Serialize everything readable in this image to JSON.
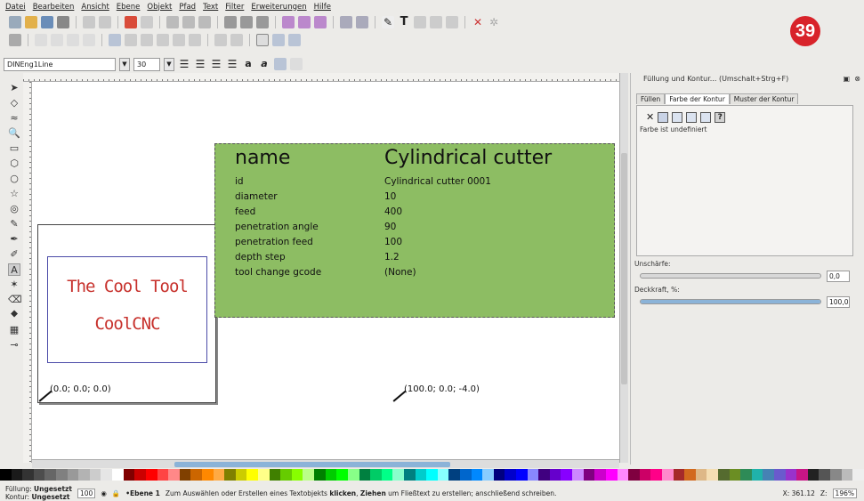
{
  "menu": [
    "Datei",
    "Bearbeiten",
    "Ansicht",
    "Ebene",
    "Objekt",
    "Pfad",
    "Text",
    "Filter",
    "Erweiterungen",
    "Hilfe"
  ],
  "badge": "39",
  "fontbar": {
    "font_family": "DINEng1Line",
    "font_size": "30"
  },
  "tools": [
    "selector-tool",
    "node-tool",
    "tweak-tool",
    "zoom-tool",
    "rect-tool",
    "box3d-tool",
    "circle-tool",
    "star-tool",
    "spiral-tool",
    "pencil-tool",
    "pen-tool",
    "calligraphy-tool",
    "text-tool",
    "spray-tool",
    "eraser-tool",
    "bucket-tool",
    "gradient-tool",
    "dropper-tool"
  ],
  "canvas": {
    "cool_tool_line1": "The Cool Tool",
    "cool_tool_line2": "CoolCNC",
    "green_box": {
      "name_label": "name",
      "name_value": "Cylindrical cutter",
      "rows": [
        {
          "label": "id",
          "value": "Cylindrical cutter 0001"
        },
        {
          "label": "diameter",
          "value": "10"
        },
        {
          "label": "feed",
          "value": "400"
        },
        {
          "label": "penetration angle",
          "value": "90"
        },
        {
          "label": "penetration feed",
          "value": "100"
        },
        {
          "label": "depth step",
          "value": "1.2"
        },
        {
          "label": "tool change gcode",
          "value": "(None)"
        }
      ]
    },
    "coord_origin": "(0.0; 0.0; 0.0)",
    "coord_target": "(100.0; 0.0; -4.0)"
  },
  "dock": {
    "title": "Füllung und Kontur... (Umschalt+Strg+F)",
    "tabs": [
      "Füllen",
      "Farbe der Kontur",
      "Muster der Kontur"
    ],
    "undefined_text": "Farbe ist undefiniert",
    "blur_label": "Unschärfe:",
    "blur_value": "0,0",
    "blur_fraction": 0.0,
    "opacity_label": "Deckkraft, %:",
    "opacity_value": "100,0",
    "opacity_fraction": 1.0
  },
  "status": {
    "fill_label": "Füllung:",
    "fill_value": "Ungesetzt",
    "stroke_label": "Kontur:",
    "stroke_value": "Ungesetzt",
    "opacity_short": "100",
    "layer": "•Ebene 1",
    "message_pre": "Zum Auswählen oder Erstellen eines Textobjekts ",
    "message_click": "klicken",
    "message_mid": ", ",
    "message_drag": "Ziehen",
    "message_post": " um Fließtext zu erstellen; anschließend schreiben.",
    "cursor_x": "X: 361.12",
    "zoom_label": "Z:",
    "zoom": "196%"
  },
  "colors": {
    "accent_badge": "#d8232a",
    "green_box": "#8dbd63",
    "cool_text": "#c7312c"
  }
}
